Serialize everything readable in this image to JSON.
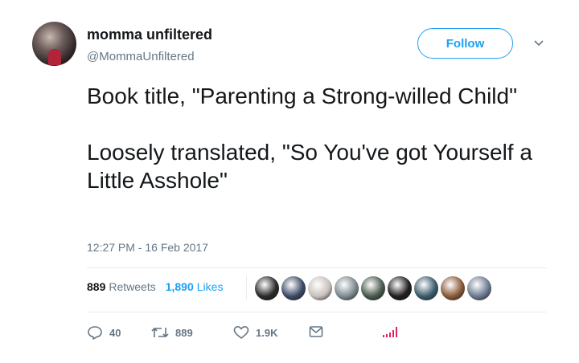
{
  "author": {
    "display_name": "momma unfiltered",
    "handle": "@MommaUnfiltered"
  },
  "follow_button": {
    "label": "Follow"
  },
  "tweet": {
    "text": "Book title, \"Parenting a Strong-willed Child\"\n\nLoosely translated, \"So You've got Yourself a Little Asshole\"",
    "timestamp": "12:27 PM - 16 Feb 2017"
  },
  "stats": {
    "retweets_count": "889",
    "retweets_label": "Retweets",
    "likes_count": "1,890",
    "likes_label": "Likes"
  },
  "likers": [
    {
      "icon": "rebel-emblem",
      "color": "#2a2a2a"
    },
    {
      "icon": "avatar",
      "color": "#3e4b66"
    },
    {
      "icon": "avatar",
      "color": "#c8c0bc"
    },
    {
      "icon": "avatar",
      "color": "#7d8a8f"
    },
    {
      "icon": "avatar",
      "color": "#4a5a4e"
    },
    {
      "icon": "avatar",
      "color": "#1f1f1f"
    },
    {
      "icon": "avatar",
      "color": "#3b5d6b"
    },
    {
      "icon": "avatar",
      "color": "#8a5a3a"
    },
    {
      "icon": "avatar",
      "color": "#6c7a90"
    }
  ],
  "actions": {
    "reply_count": "40",
    "retweet_count": "889",
    "like_count": "1.9K"
  },
  "colors": {
    "accent": "#1da1f2",
    "muted": "#657786",
    "text": "#14171a",
    "divider": "#e6ecf0"
  }
}
